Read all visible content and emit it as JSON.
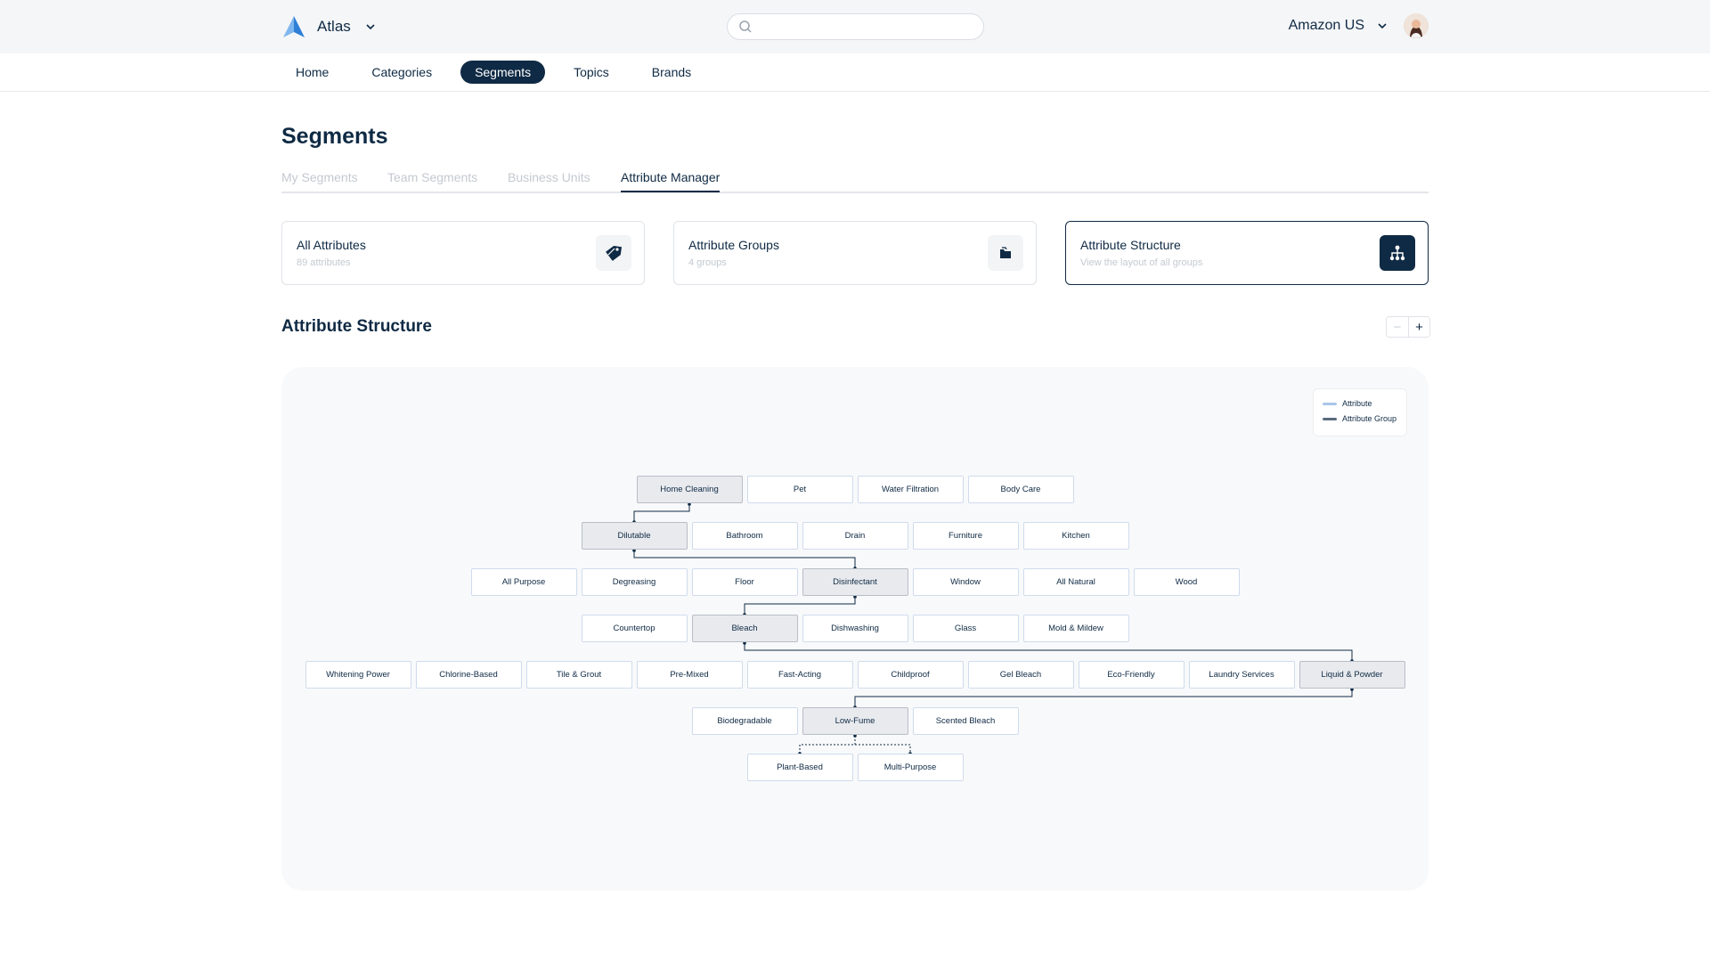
{
  "header": {
    "app_name": "Atlas",
    "search_placeholder": "",
    "account_name": "Amazon US"
  },
  "nav": {
    "items": [
      "Home",
      "Categories",
      "Segments",
      "Topics",
      "Brands"
    ],
    "active": "Segments"
  },
  "page": {
    "title": "Segments",
    "tabs": [
      "My Segments",
      "Team Segments",
      "Business Units",
      "Attribute Manager"
    ],
    "active_tab": "Attribute Manager"
  },
  "cards": [
    {
      "title": "All Attributes",
      "subtitle": "89 attributes",
      "icon": "tag-icon"
    },
    {
      "title": "Attribute Groups",
      "subtitle": "4 groups",
      "icon": "folder-icon"
    },
    {
      "title": "Attribute Structure",
      "subtitle": "View the layout of all groups",
      "icon": "hierarchy-icon"
    }
  ],
  "structure": {
    "title": "Attribute Structure",
    "legend": [
      "Attribute",
      "Attribute Group"
    ],
    "legend_colors": {
      "attribute": "#a9c6e8",
      "attribute_group": "#5b6b7f"
    },
    "rows": [
      [
        "Home Cleaning",
        "Pet",
        "Water Filtration",
        "Body Care"
      ],
      [
        "Dilutable",
        "Bathroom",
        "Drain",
        "Furniture",
        "Kitchen"
      ],
      [
        "All Purpose",
        "Degreasing",
        "Floor",
        "Disinfectant",
        "Window",
        "All Natural",
        "Wood"
      ],
      [
        "Countertop",
        "Bleach",
        "Dishwashing",
        "Glass",
        "Mold & Mildew"
      ],
      [
        "Whitening Power",
        "Chlorine-Based",
        "Tile & Grout",
        "Pre-Mixed",
        "Fast-Acting",
        "Childproof",
        "Gel Bleach",
        "Eco-Friendly",
        "Laundry Services",
        "Liquid & Powder"
      ],
      [
        "Biodegradable",
        "Low-Fume",
        "Scented Bleach"
      ],
      [
        "Plant-Based",
        "Multi-Purpose"
      ]
    ],
    "groups": [
      "Home Cleaning",
      "Dilutable",
      "Disinfectant",
      "Bleach",
      "Liquid & Powder",
      "Low-Fume"
    ]
  },
  "colors": {
    "primary": "#0f2a44",
    "muted_text": "#c4c9d0",
    "group_fill": "#e8eaee"
  }
}
